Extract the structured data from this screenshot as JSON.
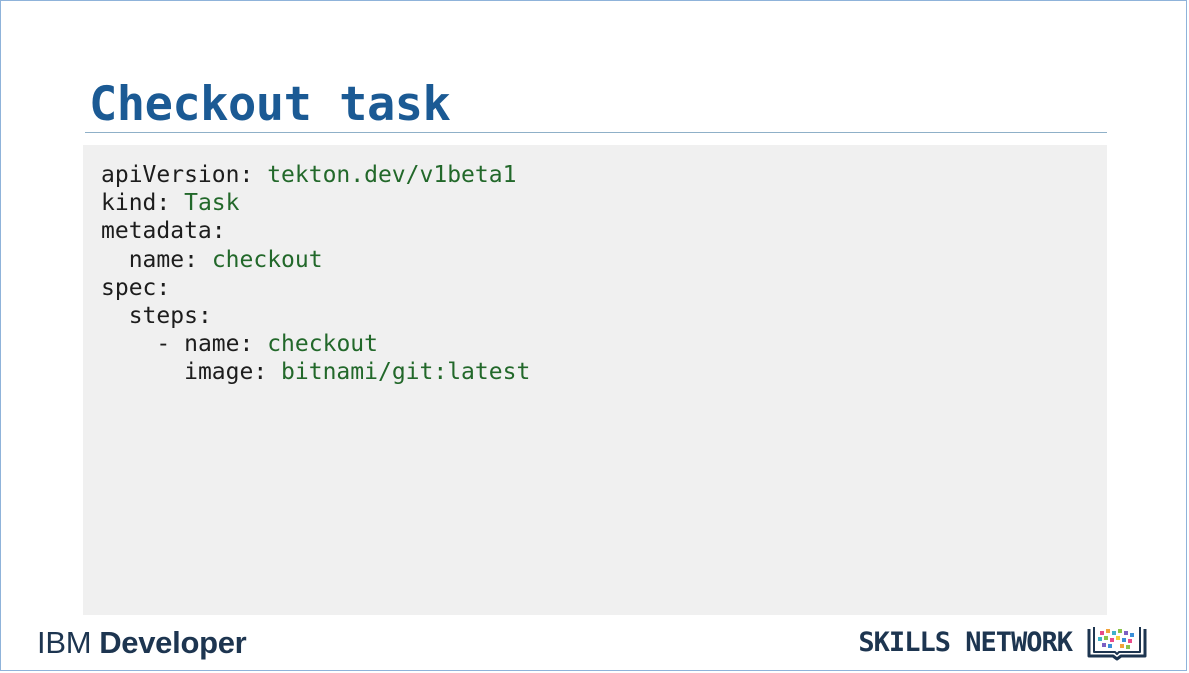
{
  "slide": {
    "title": "Checkout task"
  },
  "code": {
    "lines": [
      {
        "indent": "",
        "prefix": "",
        "key": "apiVersion:",
        "value": "tekton.dev/v1beta1"
      },
      {
        "indent": "",
        "prefix": "",
        "key": "kind:",
        "value": "Task"
      },
      {
        "indent": "",
        "prefix": "",
        "key": "metadata:",
        "value": ""
      },
      {
        "indent": "  ",
        "prefix": "",
        "key": "name:",
        "value": "checkout"
      },
      {
        "indent": "",
        "prefix": "",
        "key": "spec:",
        "value": ""
      },
      {
        "indent": "  ",
        "prefix": "",
        "key": "steps:",
        "value": ""
      },
      {
        "indent": "    ",
        "prefix": "- ",
        "key": "name:",
        "value": "checkout"
      },
      {
        "indent": "      ",
        "prefix": "",
        "key": "image:",
        "value": "bitnami/git:latest"
      }
    ]
  },
  "footer": {
    "ibm_brand_light": "IBM",
    "ibm_brand_bold": "Developer",
    "skills_network": "SKILLS NETWORK",
    "skills_logo_icon": "book-pixel-logo-icon"
  },
  "colors": {
    "title": "#1b5a94",
    "code_key": "#1d1d1d",
    "code_value": "#22682a",
    "code_background": "#f0f0f0",
    "footer_text": "#1d3550"
  }
}
